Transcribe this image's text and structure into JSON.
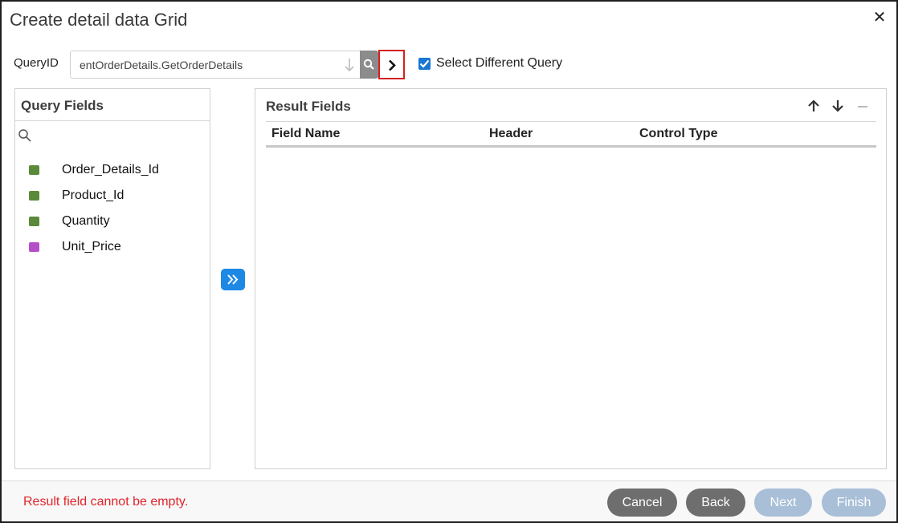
{
  "dialog": {
    "title": "Create detail data Grid",
    "close_symbol": "✕"
  },
  "query": {
    "label": "QueryID",
    "value": "entOrderDetails.GetOrderDetails",
    "select_different_label": "Select Different Query",
    "select_different_checked": true
  },
  "query_fields": {
    "title": "Query Fields",
    "items": [
      {
        "name": "Order_Details_Id",
        "color": "#5a8a3a"
      },
      {
        "name": "Product_Id",
        "color": "#5a8a3a"
      },
      {
        "name": "Quantity",
        "color": "#5a8a3a"
      },
      {
        "name": "Unit_Price",
        "color": "#b44fc8"
      }
    ]
  },
  "result_fields": {
    "title": "Result Fields",
    "columns": [
      "Field Name",
      "Header",
      "Control Type"
    ],
    "rows": []
  },
  "footer": {
    "error": "Result field cannot be empty.",
    "buttons": {
      "cancel": "Cancel",
      "back": "Back",
      "next": "Next",
      "finish": "Finish"
    }
  },
  "colors": {
    "primary": "#1e88e5",
    "error": "#e0242a",
    "disabled_button": "#a9bfd8",
    "secondary_button": "#6e6e6e"
  }
}
